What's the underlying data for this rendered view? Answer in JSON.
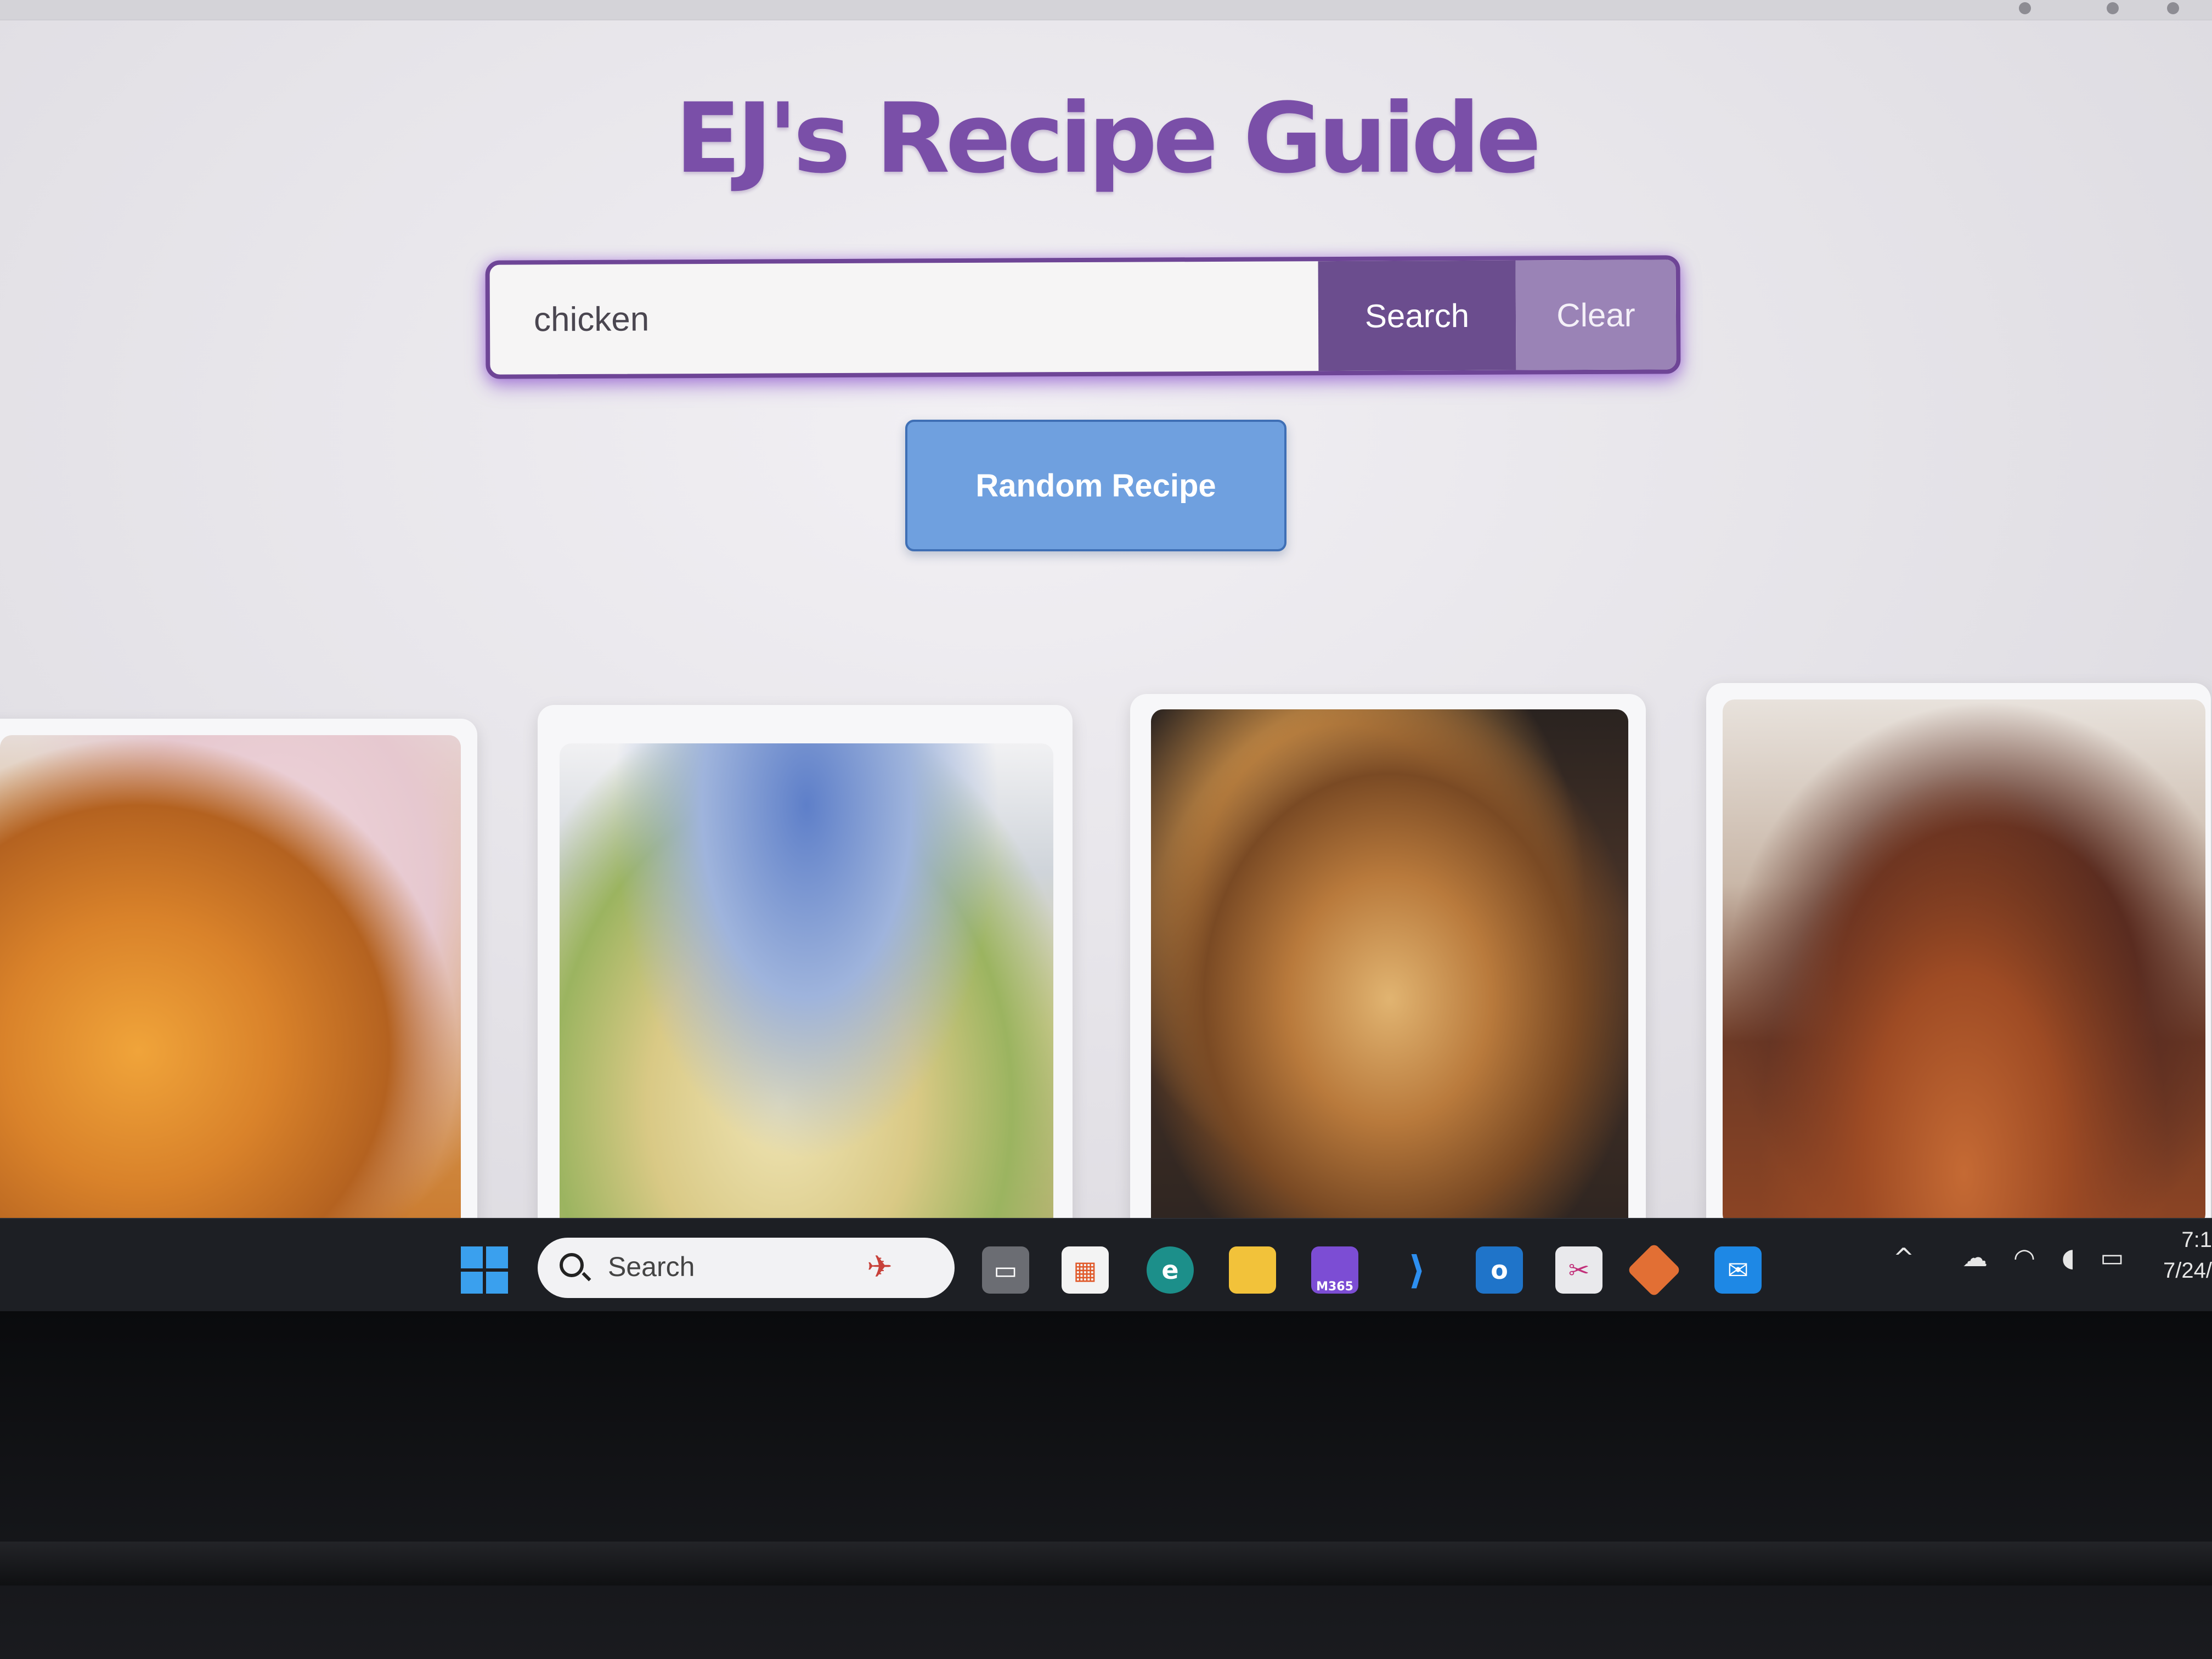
{
  "page": {
    "title": "EJ's Recipe Guide",
    "search": {
      "value": "chicken",
      "search_label": "Search",
      "clear_label": "Clear"
    },
    "random_label": "Random Recipe",
    "recipes": [
      {
        "image_alt": ""
      },
      {
        "image_alt": ""
      },
      {
        "image_alt": ""
      },
      {
        "image_alt": ""
      }
    ]
  },
  "taskbar": {
    "search_label": "Search",
    "apps": [
      {
        "icon": "task-view-icon"
      },
      {
        "icon": "microsoft-store-icon"
      },
      {
        "icon": "edge-browser-icon"
      },
      {
        "icon": "file-explorer-icon"
      },
      {
        "icon": "microsoft-365-icon",
        "label": "M365"
      },
      {
        "icon": "vscode-icon"
      },
      {
        "icon": "outlook-icon"
      },
      {
        "icon": "snipping-tool-icon"
      },
      {
        "icon": "git-icon"
      },
      {
        "icon": "mail-icon"
      }
    ],
    "tray": [
      "chevron-up-icon",
      "cloud-off-icon",
      "wifi-icon",
      "volume-icon",
      "battery-icon"
    ],
    "clock_time": "7:1",
    "clock_date": "7/24/"
  },
  "colors": {
    "title": "#7a4fa8",
    "search_border": "#6e4596",
    "search_button": "#6b4d8e",
    "clear_button": "#9a83b6",
    "random_button": "#6fa0df",
    "taskbar": "#1d1f24"
  }
}
